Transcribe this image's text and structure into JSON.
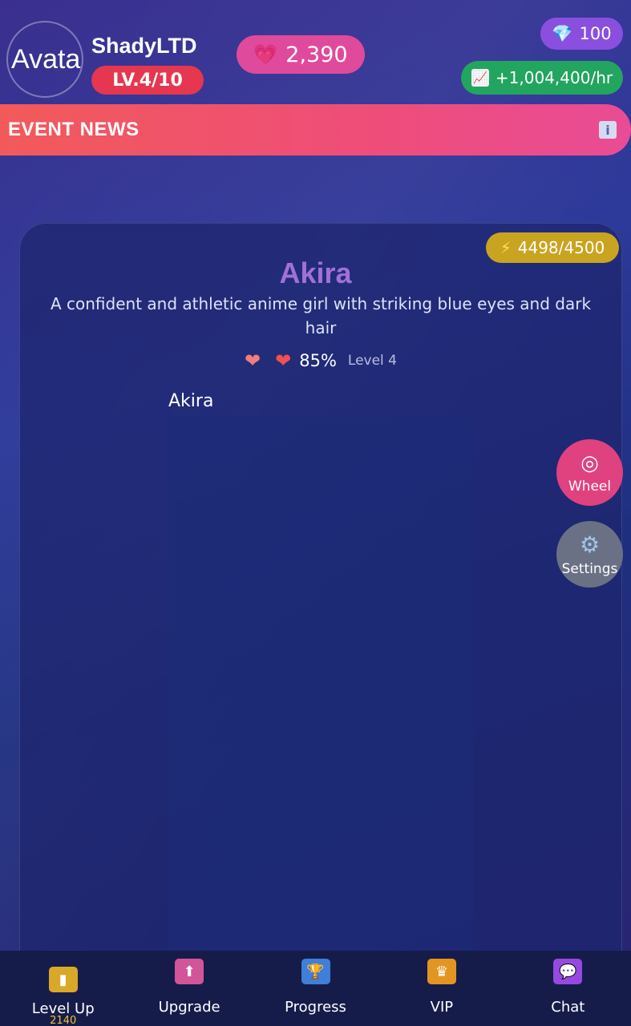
{
  "header": {
    "avatar_alt": "Avatar",
    "username": "ShadyLTD",
    "level": "LV.4/10",
    "hearts": "2,390",
    "gems": "100",
    "income": "+1,004,400/hr"
  },
  "event_bar": {
    "title": "EVENT NEWS",
    "info_glyph": "i"
  },
  "character": {
    "energy": "4498/4500",
    "name": "Akira",
    "description": "A confident and athletic anime girl with striking blue eyes and dark hair",
    "affection": "85%",
    "level": "Level 4",
    "portrait_label": "Akira"
  },
  "floating": {
    "wheel_label": "Wheel",
    "settings_label": "Settings"
  },
  "nav": {
    "items": [
      {
        "label": "Level Up",
        "sub": "2140"
      },
      {
        "label": "Upgrade"
      },
      {
        "label": "Progress"
      },
      {
        "label": "VIP"
      },
      {
        "label": "Chat"
      }
    ]
  },
  "icons": {
    "heart": "heart-icon",
    "gem": "gem-icon",
    "income": "chart-up-icon",
    "energy": "lightning-icon",
    "wheel": "target-icon",
    "settings": "gear-icon"
  }
}
